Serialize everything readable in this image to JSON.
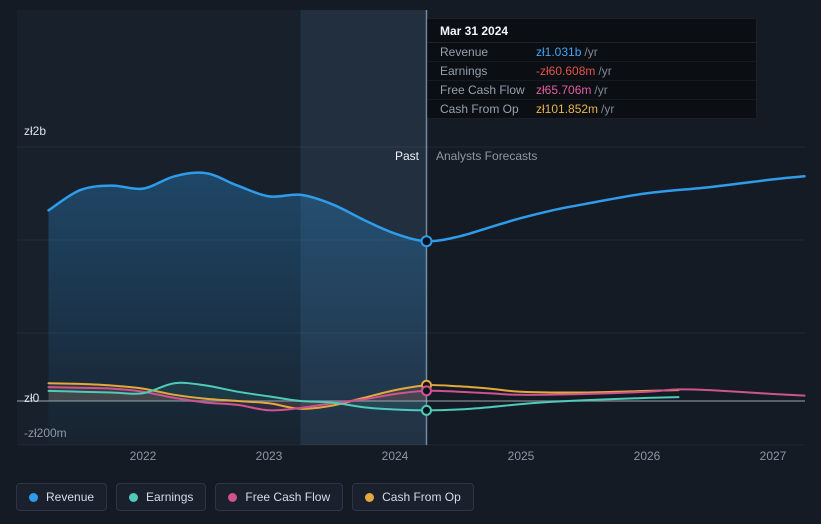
{
  "tooltip": {
    "date": "Mar 31 2024",
    "rows": [
      {
        "label": "Revenue",
        "value": "zł1.031b",
        "suffix": "/yr",
        "value_color": "#42a5f5"
      },
      {
        "label": "Earnings",
        "value": "-zł60.608m",
        "suffix": "/yr",
        "value_color": "#e5534b"
      },
      {
        "label": "Free Cash Flow",
        "value": "zł65.706m",
        "suffix": "/yr",
        "value_color": "#e0609f"
      },
      {
        "label": "Cash From Op",
        "value": "zł101.852m",
        "suffix": "/yr",
        "value_color": "#e8b54d"
      }
    ]
  },
  "zones": {
    "past": "Past",
    "forecast": "Analysts Forecasts"
  },
  "axis": {
    "y_labels": [
      {
        "text": "zł2b"
      },
      {
        "text": "zł0"
      },
      {
        "text": "-zł200m"
      }
    ],
    "x_ticks": [
      "2022",
      "2023",
      "2024",
      "2025",
      "2026",
      "2027"
    ]
  },
  "legend": [
    {
      "label": "Revenue",
      "color": "#2f9ceb"
    },
    {
      "label": "Earnings",
      "color": "#4ecbb9"
    },
    {
      "label": "Free Cash Flow",
      "color": "#cf5291"
    },
    {
      "label": "Cash From Op",
      "color": "#e3a93c"
    }
  ],
  "colors": {
    "background": "#151b24",
    "zero_line": "#dfe8f1",
    "divider_line": "#a9cdf0",
    "highlight_band": "#6ea0d7"
  },
  "chart_data": {
    "type": "line",
    "title": "",
    "y_unit": "zł billions",
    "x_unit": "year",
    "xlim": [
      2021.25,
      2027.3
    ],
    "ylim": [
      -0.28,
      2.0
    ],
    "grid": true,
    "legend_position": "bottom",
    "past_forecast_divider_x": 2024.25,
    "highlight_band_x": [
      2023.25,
      2024.25
    ],
    "marker_x": 2024.25,
    "series": [
      {
        "name": "Revenue",
        "color": "#2f9ceb",
        "area_fill_past": true,
        "points": [
          [
            2021.25,
            1.23
          ],
          [
            2021.5,
            1.36
          ],
          [
            2021.75,
            1.39
          ],
          [
            2022.0,
            1.37
          ],
          [
            2022.25,
            1.45
          ],
          [
            2022.5,
            1.47
          ],
          [
            2022.75,
            1.39
          ],
          [
            2023.0,
            1.32
          ],
          [
            2023.25,
            1.33
          ],
          [
            2023.5,
            1.27
          ],
          [
            2023.75,
            1.17
          ],
          [
            2024.0,
            1.08
          ],
          [
            2024.25,
            1.031
          ],
          [
            2024.5,
            1.06
          ],
          [
            2024.75,
            1.12
          ],
          [
            2025.0,
            1.18
          ],
          [
            2025.25,
            1.23
          ],
          [
            2025.5,
            1.27
          ],
          [
            2026.0,
            1.34
          ],
          [
            2026.5,
            1.38
          ],
          [
            2027.0,
            1.43
          ],
          [
            2027.25,
            1.45
          ]
        ]
      },
      {
        "name": "Earnings",
        "color": "#4ecbb9",
        "area_fill_past": false,
        "points": [
          [
            2021.25,
            0.065
          ],
          [
            2021.5,
            0.06
          ],
          [
            2021.75,
            0.055
          ],
          [
            2022.0,
            0.05
          ],
          [
            2022.25,
            0.115
          ],
          [
            2022.5,
            0.1
          ],
          [
            2022.75,
            0.06
          ],
          [
            2023.0,
            0.03
          ],
          [
            2023.25,
            0.0
          ],
          [
            2023.5,
            -0.01
          ],
          [
            2023.75,
            -0.04
          ],
          [
            2024.0,
            -0.055
          ],
          [
            2024.25,
            -0.0606
          ],
          [
            2024.5,
            -0.055
          ],
          [
            2024.75,
            -0.04
          ],
          [
            2025.0,
            -0.02
          ],
          [
            2025.25,
            -0.005
          ],
          [
            2025.5,
            0.005
          ],
          [
            2026.0,
            0.02
          ],
          [
            2026.25,
            0.025
          ]
        ]
      },
      {
        "name": "Free Cash Flow",
        "color": "#cf5291",
        "area_fill_past": false,
        "points": [
          [
            2021.25,
            0.09
          ],
          [
            2021.5,
            0.085
          ],
          [
            2021.75,
            0.08
          ],
          [
            2022.0,
            0.06
          ],
          [
            2022.25,
            0.02
          ],
          [
            2022.5,
            -0.01
          ],
          [
            2022.75,
            -0.025
          ],
          [
            2023.0,
            -0.06
          ],
          [
            2023.25,
            -0.045
          ],
          [
            2023.5,
            -0.015
          ],
          [
            2023.75,
            0.01
          ],
          [
            2024.0,
            0.045
          ],
          [
            2024.25,
            0.0657
          ],
          [
            2024.5,
            0.06
          ],
          [
            2024.75,
            0.05
          ],
          [
            2025.0,
            0.04
          ],
          [
            2025.5,
            0.045
          ],
          [
            2026.0,
            0.06
          ],
          [
            2026.25,
            0.075
          ],
          [
            2026.5,
            0.07
          ],
          [
            2027.0,
            0.045
          ],
          [
            2027.25,
            0.035
          ]
        ]
      },
      {
        "name": "Cash From Op",
        "color": "#e3a93c",
        "area_fill_past": false,
        "points": [
          [
            2021.25,
            0.115
          ],
          [
            2021.5,
            0.11
          ],
          [
            2021.75,
            0.1
          ],
          [
            2022.0,
            0.08
          ],
          [
            2022.25,
            0.04
          ],
          [
            2022.5,
            0.015
          ],
          [
            2022.75,
            0.0
          ],
          [
            2023.0,
            -0.015
          ],
          [
            2023.25,
            -0.05
          ],
          [
            2023.5,
            -0.03
          ],
          [
            2023.75,
            0.02
          ],
          [
            2024.0,
            0.07
          ],
          [
            2024.25,
            0.1019
          ],
          [
            2024.5,
            0.095
          ],
          [
            2024.75,
            0.08
          ],
          [
            2025.0,
            0.06
          ],
          [
            2025.5,
            0.055
          ],
          [
            2026.0,
            0.065
          ],
          [
            2026.25,
            0.07
          ]
        ]
      }
    ]
  }
}
